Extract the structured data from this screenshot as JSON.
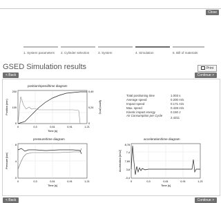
{
  "header": {
    "close_label": "Close"
  },
  "steps": [
    {
      "label": "1. System parameters",
      "active": false
    },
    {
      "label": "2. Cylinder selection",
      "active": false
    },
    {
      "label": "3. System",
      "active": false
    },
    {
      "label": "4. Simulation",
      "active": true
    },
    {
      "label": "5. Bill of materials",
      "active": false
    }
  ],
  "page": {
    "title": "GSED  Simulation results",
    "print_label": "Print",
    "back_label": "< Back",
    "continue_label": "Continue >"
  },
  "results": [
    {
      "label": "Total positioning time",
      "value": "1.003  s"
    },
    {
      "label": "Average speed",
      "value": "0.200 m/s"
    },
    {
      "label": "Impact speed",
      "value": "0.171 m/s"
    },
    {
      "label": "Max. speed",
      "value": "0.428 m/s"
    },
    {
      "label": "Kinetic impact energy",
      "value": "0.150 J"
    },
    {
      "label": "Air Consumption per Cycle",
      "value": "2.4211"
    }
  ],
  "charts": {
    "position": {
      "title": "position/speed/time diagram",
      "ylabel_left": "Position (mm)",
      "ylabel_right": "Speed (m/s)",
      "xlabel": "Time [s]",
      "y_ticks_left": [
        "200",
        "100",
        "0"
      ],
      "y_ticks_right": [
        "0,49",
        "0,24",
        "0"
      ],
      "x_ticks": [
        "0",
        "0,3",
        "0,61",
        "0,91",
        "1,21"
      ]
    },
    "pressure": {
      "title": "pressure/time diagram",
      "ylabel": "Pressure [bar]",
      "xlabel": "Time [s]",
      "y_ticks": [
        "8",
        "4",
        "0"
      ],
      "x_ticks": [
        "0",
        "0,3",
        "0,61",
        "0,91",
        "1,21"
      ]
    },
    "acceleration": {
      "title": "acceleration/time diagram",
      "ylabel": "Acceleration [m/s2]",
      "xlabel": "Time [s]",
      "y_ticks": [
        "8,78",
        "7,4",
        "7,69",
        "3,8",
        "-0,4"
      ],
      "x_ticks": [
        "0",
        "0,3",
        "0,61",
        "0,91",
        "1,21"
      ]
    }
  },
  "colors": {
    "button_dark": "#6f6f6f",
    "active_step": "#6b6b6b",
    "inactive_step": "#b9b9b9"
  }
}
